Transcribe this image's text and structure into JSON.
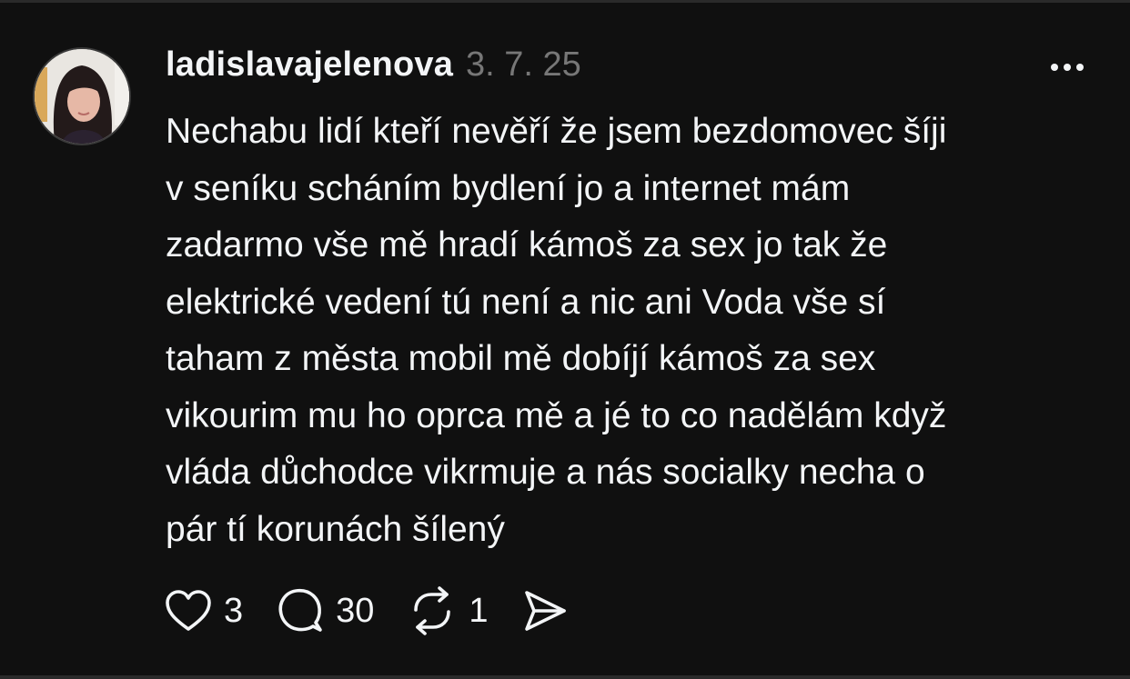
{
  "post": {
    "username": "ladislavajelenova",
    "date": "3. 7. 25",
    "text": "Nechabu lidí kteří nevěří že jsem bezdomovec šíji\nv seníku scháním bydlení jo a internet mám\nzadarmo vše mě hradí kámoš za sex jo tak že\nelektrické vedení tú není a nic ani Voda vše sí\ntaham z města mobil mě dobíjí kámoš za sex\nvikourim mu ho oprca mě a jé to co nadělám když\nvláda důchodce vikrmuje a nás socialky necha o\npár tí korunách šílený",
    "more_icon": "more-horizontal-icon"
  },
  "actions": {
    "like": {
      "icon": "heart-icon",
      "count": "3"
    },
    "reply": {
      "icon": "comment-icon",
      "count": "30"
    },
    "repost": {
      "icon": "repost-icon",
      "count": "1"
    },
    "share": {
      "icon": "send-icon"
    }
  },
  "colors": {
    "background": "#101010",
    "text": "#f3f5f7",
    "muted": "#777777"
  }
}
